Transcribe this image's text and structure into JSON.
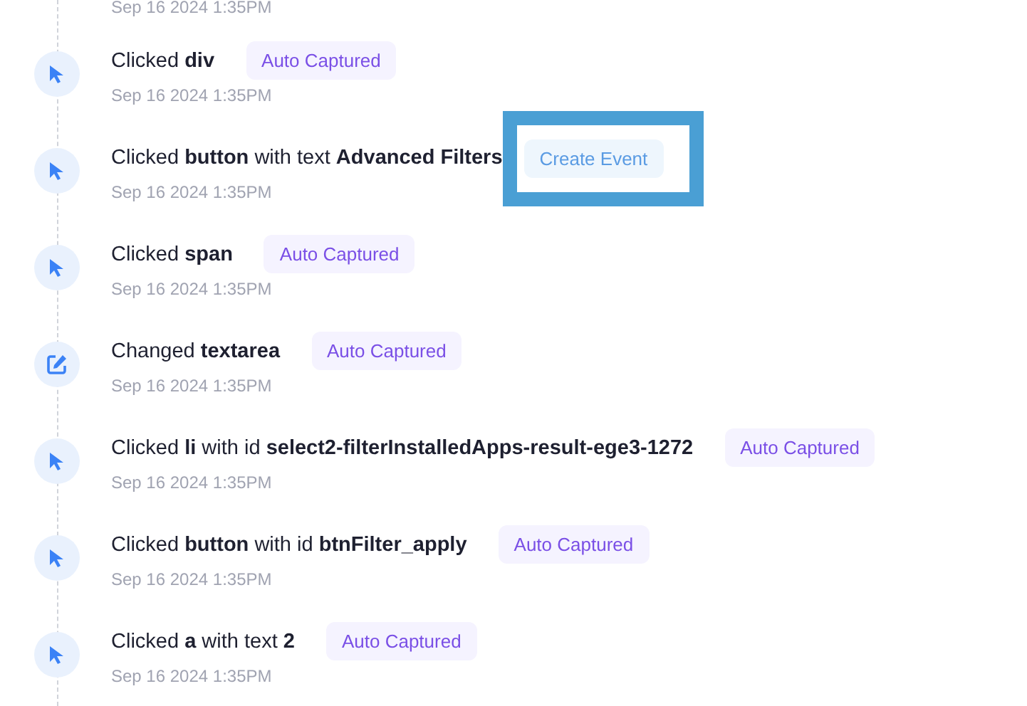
{
  "top_timestamp": "Sep 16 2024 1:35PM",
  "events": [
    {
      "kind": "click",
      "title": "Clicked **div**",
      "timestamp": "Sep 16 2024 1:35PM",
      "badge": {
        "kind": "auto",
        "label": "Auto Captured",
        "highlighted": false
      }
    },
    {
      "kind": "click",
      "title": "Clicked **button** with text **Advanced Filters**",
      "timestamp": "Sep 16 2024 1:35PM",
      "badge": {
        "kind": "action",
        "label": "Create Event",
        "highlighted": true
      }
    },
    {
      "kind": "click",
      "title": "Clicked **span**",
      "timestamp": "Sep 16 2024 1:35PM",
      "badge": {
        "kind": "auto",
        "label": "Auto Captured",
        "highlighted": false
      }
    },
    {
      "kind": "change",
      "title": "Changed **textarea**",
      "timestamp": "Sep 16 2024 1:35PM",
      "badge": {
        "kind": "auto",
        "label": "Auto Captured",
        "highlighted": false
      }
    },
    {
      "kind": "click",
      "title": "Clicked **li** with id **select2-filterInstalledApps-result-ege3-1272**",
      "timestamp": "Sep 16 2024 1:35PM",
      "badge": {
        "kind": "auto",
        "label": "Auto Captured",
        "highlighted": false
      }
    },
    {
      "kind": "click",
      "title": "Clicked **button** with id **btnFilter_apply**",
      "timestamp": "Sep 16 2024 1:35PM",
      "badge": {
        "kind": "auto",
        "label": "Auto Captured",
        "highlighted": false
      }
    },
    {
      "kind": "click",
      "title": "Clicked **a** with text **2**",
      "timestamp": "Sep 16 2024 1:35PM",
      "badge": {
        "kind": "auto",
        "label": "Auto Captured",
        "highlighted": false
      }
    }
  ]
}
